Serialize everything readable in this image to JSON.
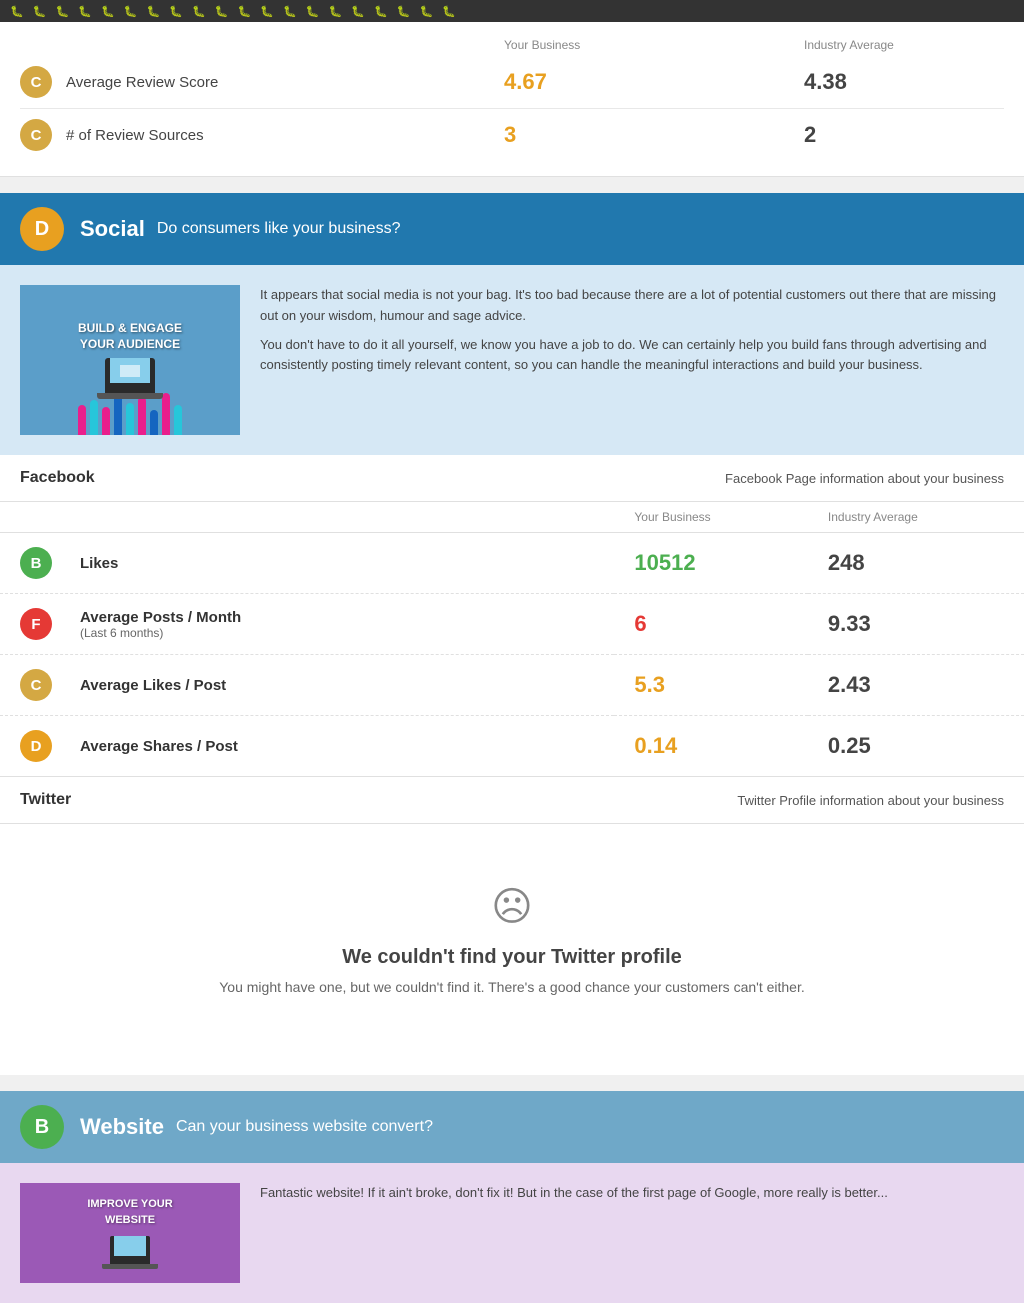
{
  "bugBar": {
    "content": "🐛 🐛 🐛 🐛 🐛 🐛 🐛 🐛 🐛 🐛 🐛 🐛 🐛 🐛 🐛 🐛 🐛 🐛 🐛 🐛"
  },
  "topMetrics": {
    "columnHeaders": {
      "yourBusiness": "Your Business",
      "industryAverage": "Industry Average"
    },
    "rows": [
      {
        "grade": "C",
        "gradeClass": "badge-c",
        "label": "Average Review Score",
        "yourValue": "4.67",
        "yourValueClass": "val-orange",
        "industryValue": "4.38"
      },
      {
        "grade": "C",
        "gradeClass": "badge-c",
        "label": "# of Review Sources",
        "yourValue": "3",
        "yourValueClass": "val-orange",
        "industryValue": "2"
      }
    ]
  },
  "socialSection": {
    "badgeGrade": "D",
    "badgeClass": "badge-d",
    "title": "Social",
    "subtitle": "Do consumers like your business?",
    "bannerClass": "banner-social",
    "promoImageText": "BUILD & ENGAGE\nYOUR AUDIENCE",
    "promoText": "It appears that social media is not your bag. It's too bad because there are a lot of potential customers out there that are missing out on your wisdom, humour and sage advice.\nYou don't have to do it all yourself, we know you have a job to do. We can certainly help you build fans through advertising and consistently posting timely relevant content, so you can handle the meaningful interactions and build your business.",
    "facebook": {
      "title": "Facebook",
      "info": "Facebook Page information about your business",
      "columnHeaders": {
        "yourBusiness": "Your Business",
        "industryAverage": "Industry Average"
      },
      "rows": [
        {
          "grade": "B",
          "gradeClass": "badge-b",
          "label": "Likes",
          "subLabel": "",
          "yourValue": "10512",
          "yourValueClass": "val-green",
          "industryValue": "248"
        },
        {
          "grade": "F",
          "gradeClass": "badge-f",
          "label": "Average Posts / Month",
          "subLabel": "(Last 6 months)",
          "yourValue": "6",
          "yourValueClass": "val-red",
          "industryValue": "9.33"
        },
        {
          "grade": "C",
          "gradeClass": "badge-c",
          "label": "Average Likes / Post",
          "subLabel": "",
          "yourValue": "5.3",
          "yourValueClass": "val-orange",
          "industryValue": "2.43"
        },
        {
          "grade": "D",
          "gradeClass": "badge-d",
          "label": "Average Shares / Post",
          "subLabel": "",
          "yourValue": "0.14",
          "yourValueClass": "val-orange",
          "industryValue": "0.25"
        }
      ]
    },
    "twitter": {
      "title": "Twitter",
      "info": "Twitter Profile information about your business",
      "notFoundEmoji": "☹",
      "notFoundTitle": "We couldn't find your Twitter profile",
      "notFoundText": "You might have one, but we couldn't find it. There's a good chance your customers can't either."
    }
  },
  "websiteSection": {
    "badgeGrade": "B",
    "badgeClass": "badge-b",
    "title": "Website",
    "subtitle": "Can your business website convert?",
    "bannerClass": "banner-website",
    "promoImageText": "IMPROVE YOUR\nWEBSITE",
    "promoText": "Fantastic website! If it ain't broke, don't fix it! But in the case of the first page of Google, more really is better..."
  }
}
